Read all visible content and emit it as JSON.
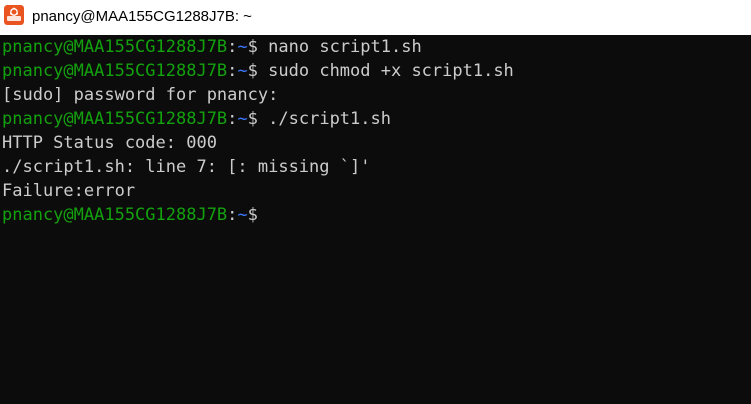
{
  "window": {
    "title": "pnancy@MAA155CG1288J7B: ~",
    "icon": "ubuntu-icon"
  },
  "colors": {
    "background": "#0c0c0c",
    "prompt_user": "#13a10e",
    "prompt_path": "#3b78ff",
    "output_text": "#cccccc",
    "icon_accent": "#e95420"
  },
  "terminal": {
    "lines": [
      {
        "kind": "prompt",
        "user": "pnancy@MAA155CG1288J7B",
        "sep": ":",
        "path": "~",
        "sym": "$",
        "cmd": " nano script1.sh"
      },
      {
        "kind": "prompt",
        "user": "pnancy@MAA155CG1288J7B",
        "sep": ":",
        "path": "~",
        "sym": "$",
        "cmd": " sudo chmod +x script1.sh"
      },
      {
        "kind": "output",
        "text": "[sudo] password for pnancy:"
      },
      {
        "kind": "prompt",
        "user": "pnancy@MAA155CG1288J7B",
        "sep": ":",
        "path": "~",
        "sym": "$",
        "cmd": " ./script1.sh"
      },
      {
        "kind": "output",
        "text": "HTTP Status code: 000"
      },
      {
        "kind": "output",
        "text": "./script1.sh: line 7: [: missing `]'"
      },
      {
        "kind": "output",
        "text": "Failure:error"
      },
      {
        "kind": "prompt",
        "user": "pnancy@MAA155CG1288J7B",
        "sep": ":",
        "path": "~",
        "sym": "$",
        "cmd": ""
      }
    ]
  }
}
